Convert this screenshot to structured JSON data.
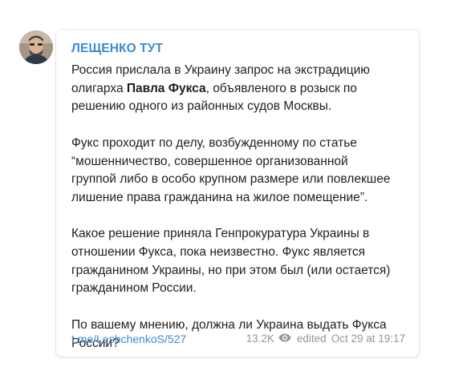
{
  "post": {
    "channel_name": "ЛЕЩЕНКО ТУТ",
    "paragraphs": [
      {
        "lines": [
          [
            "Россия прислала в Украину запрос на экстрадицию"
          ],
          [
            "олигарха ",
            {
              "bold": "Павла Фукса"
            },
            ", объявленого в розыск по"
          ],
          [
            "решению одного из районных судов Москвы."
          ]
        ]
      },
      {
        "lines": [
          [
            "Фукс проходит по делу, возбужденному по статье"
          ],
          [
            "“мошенничество, совершенное организованной"
          ],
          [
            "группой либо в особо крупном размере или повлекшее"
          ],
          [
            "лишение права гражданина на жилое помещение”."
          ]
        ]
      },
      {
        "lines": [
          [
            "Какое решение приняла Генпрокуратура Украины в"
          ],
          [
            "отношении Фукса, пока неизвестно. Фукс является"
          ],
          [
            "гражданином Украины, но при этом был (или остается)"
          ],
          [
            "гражданином России."
          ]
        ]
      },
      {
        "lines": [
          [
            "По вашему мнению, должна ли Украина выдать Фукса"
          ],
          [
            "России?"
          ]
        ]
      }
    ],
    "link": "t.me/LeshchenkoS/527",
    "views": "13.2K",
    "views_icon": "eye-icon",
    "edited_label": "edited",
    "date": "Oct 29 at 19:17"
  },
  "colors": {
    "accent": "#3c8bd0",
    "text": "#1f1f1f",
    "meta": "#8f969e",
    "border": "#e3e6ea"
  }
}
